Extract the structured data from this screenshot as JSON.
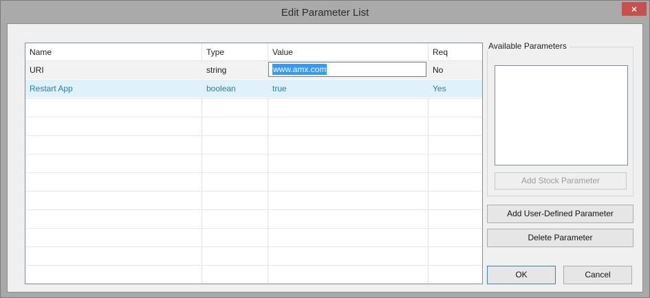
{
  "dialog": {
    "title": "Edit Parameter List",
    "close_label": "×"
  },
  "table": {
    "columns": [
      "Name",
      "Type",
      "Value",
      "Req"
    ],
    "rows": [
      {
        "name": "URI",
        "type": "string",
        "value": "www.amx.com",
        "req": "No"
      },
      {
        "name": "Restart App",
        "type": "boolean",
        "value": "true",
        "req": "Yes"
      }
    ]
  },
  "available": {
    "label": "Available Parameters",
    "items": []
  },
  "buttons": {
    "add_stock": "Add Stock Parameter",
    "add_user": "Add User-Defined Parameter",
    "delete": "Delete Parameter",
    "ok": "OK",
    "cancel": "Cancel"
  },
  "colors": {
    "selected_row_text": "#2a7ab5",
    "selected_row_bg": "#dff2fb",
    "close_button": "#c7504a"
  }
}
